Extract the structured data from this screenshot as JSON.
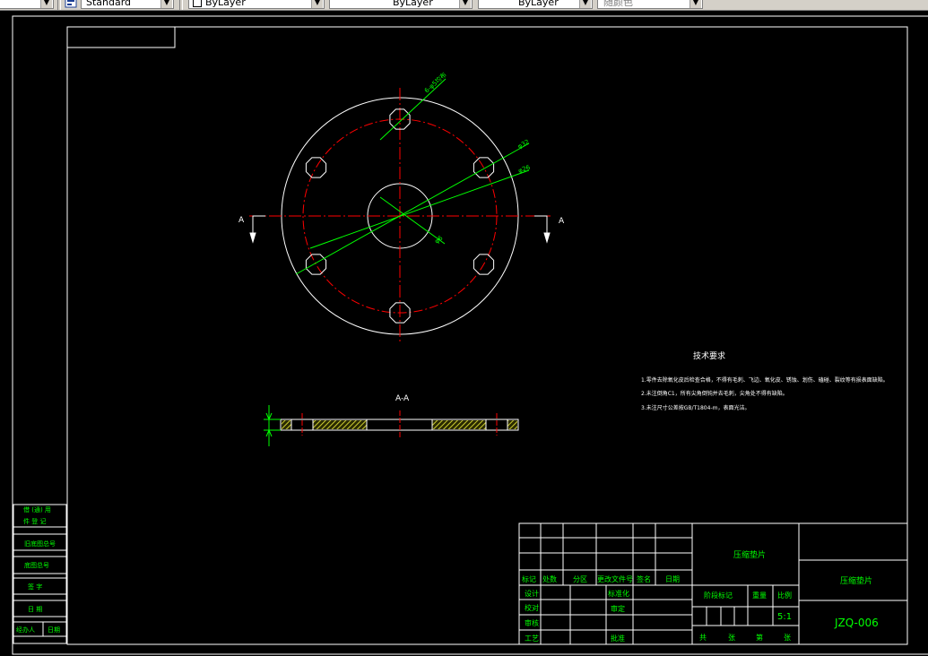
{
  "toolbar": {
    "text_style": "",
    "dim_style": "Standard",
    "layer": "ByLayer",
    "linetype": "ByLayer",
    "lineweight": "ByLayer",
    "plot_style": "随颜色"
  },
  "colors": {
    "background": "#000000",
    "outline": "#ffffff",
    "centerline": "#ff0000",
    "dimension": "#00ff00",
    "hatch": "#cccc33"
  },
  "drawing": {
    "plan_view": {
      "dims": {
        "holes": "6-φ5均布",
        "outer_dia": "φ32",
        "pitch_dia": "φ26",
        "center_dia": "φ6"
      },
      "section_marker": "A"
    },
    "section_view": {
      "title": "A-A"
    },
    "notes": {
      "title": "技术要求",
      "lines": [
        "1.零件去除氧化皮后检查合格，不得有毛刺、飞边、氧化皮、锈蚀、划伤、磕碰、裂纹等有损表面缺陷。",
        "2.未注倒角C1，所有尖角倒钝并去毛刺，尖角处不得有缺陷。",
        "3.未注尺寸公差按GB/T1804-m，表面光洁。"
      ]
    }
  },
  "left_strip": {
    "labels": [
      "借 (通) 用",
      "件 登 记",
      "旧底图总号",
      "底图总号",
      "签  字",
      "日  期",
      "经办人",
      "日期"
    ]
  },
  "title_block": {
    "change_headers": [
      "标记",
      "处数",
      "分区",
      "更改文件号",
      "签名",
      "日期"
    ],
    "roles": [
      "设计",
      "校对",
      "审核",
      "工艺"
    ],
    "mid_labels": [
      "标准化",
      "审定",
      "批准"
    ],
    "part_name": "压缩垫片",
    "stage_label": "阶段标记",
    "weight_label": "重量",
    "scale_label": "比例",
    "scale_value": "5:1",
    "sheet_labels": [
      "共",
      "张",
      "第",
      "张"
    ],
    "right_name": "压缩垫片",
    "drawing_no": "JZQ-006"
  }
}
